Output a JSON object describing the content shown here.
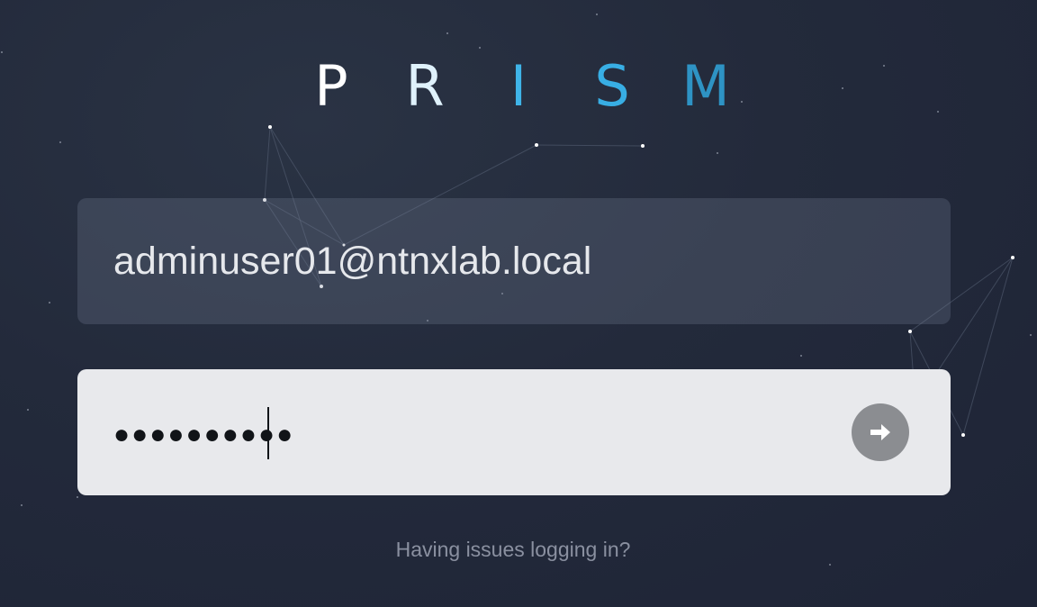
{
  "logo": {
    "letters": [
      {
        "char": "P",
        "color": "#ffffff"
      },
      {
        "char": "R",
        "color": "#dff1fb"
      },
      {
        "char": "I",
        "color": "#3fb4e8"
      },
      {
        "char": "S",
        "color": "#38aee4"
      },
      {
        "char": "M",
        "color": "#2e93c4"
      }
    ]
  },
  "login": {
    "username_value": "adminuser01@ntnxlab.local",
    "password_mask": "●●●●●●●●●●",
    "submit_icon": "arrow-right-icon",
    "help_link": "Having issues logging in?"
  },
  "colors": {
    "background": "#232a3b",
    "username_field_bg": "#3a4150",
    "password_field_bg": "#e8e9ec",
    "submit_button_bg": "#8b8d91",
    "help_text": "#8a90a0"
  }
}
